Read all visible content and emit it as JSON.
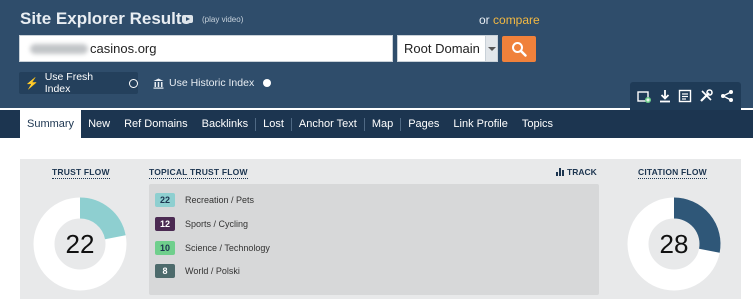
{
  "header": {
    "title": "Site Explorer Results",
    "play_video": "(play video)",
    "or_text": "or",
    "compare_link": "compare",
    "url_value": "casinos.org",
    "scope_value": "Root Domain",
    "fresh_index_label": "Use Fresh Index",
    "historic_index_label": "Use Historic Index",
    "colors": {
      "header_bg": "#2f4d6b",
      "tabs_bg": "#1c3550",
      "accent_orange": "#f0813b",
      "compare_link": "#f4b942"
    }
  },
  "toolbar": {
    "icons": [
      "add-bucket-icon",
      "download-icon",
      "report-icon",
      "tools-icon",
      "share-icon"
    ]
  },
  "tabs": [
    {
      "label": "Summary",
      "active": true
    },
    {
      "label": "New"
    },
    {
      "label": "Ref Domains"
    },
    {
      "label": "Backlinks"
    },
    {
      "label": "Lost"
    },
    {
      "label": "Anchor Text"
    },
    {
      "label": "Map"
    },
    {
      "label": "Pages"
    },
    {
      "label": "Link Profile"
    },
    {
      "label": "Topics"
    }
  ],
  "summary": {
    "trust_flow": {
      "label": "TRUST FLOW",
      "value": "22",
      "fraction": 0.22,
      "color": "#8ecfd0"
    },
    "citation_flow": {
      "label": "CITATION FLOW",
      "value": "28",
      "fraction": 0.28,
      "color": "#2f5778"
    },
    "topical_trust_flow": {
      "label": "TOPICAL TRUST FLOW",
      "track_label": "TRACK",
      "items": [
        {
          "value": "22",
          "topic": "Recreation / Pets",
          "color": "#8ecfd0",
          "text_color": "#1c3550"
        },
        {
          "value": "12",
          "topic": "Sports / Cycling",
          "color": "#4b2a52",
          "text_color": "#ffffff"
        },
        {
          "value": "10",
          "topic": "Science / Technology",
          "color": "#6fcf8c",
          "text_color": "#1c3550"
        },
        {
          "value": "8",
          "topic": "World / Polski",
          "color": "#4d6b6c",
          "text_color": "#ffffff"
        }
      ]
    }
  }
}
